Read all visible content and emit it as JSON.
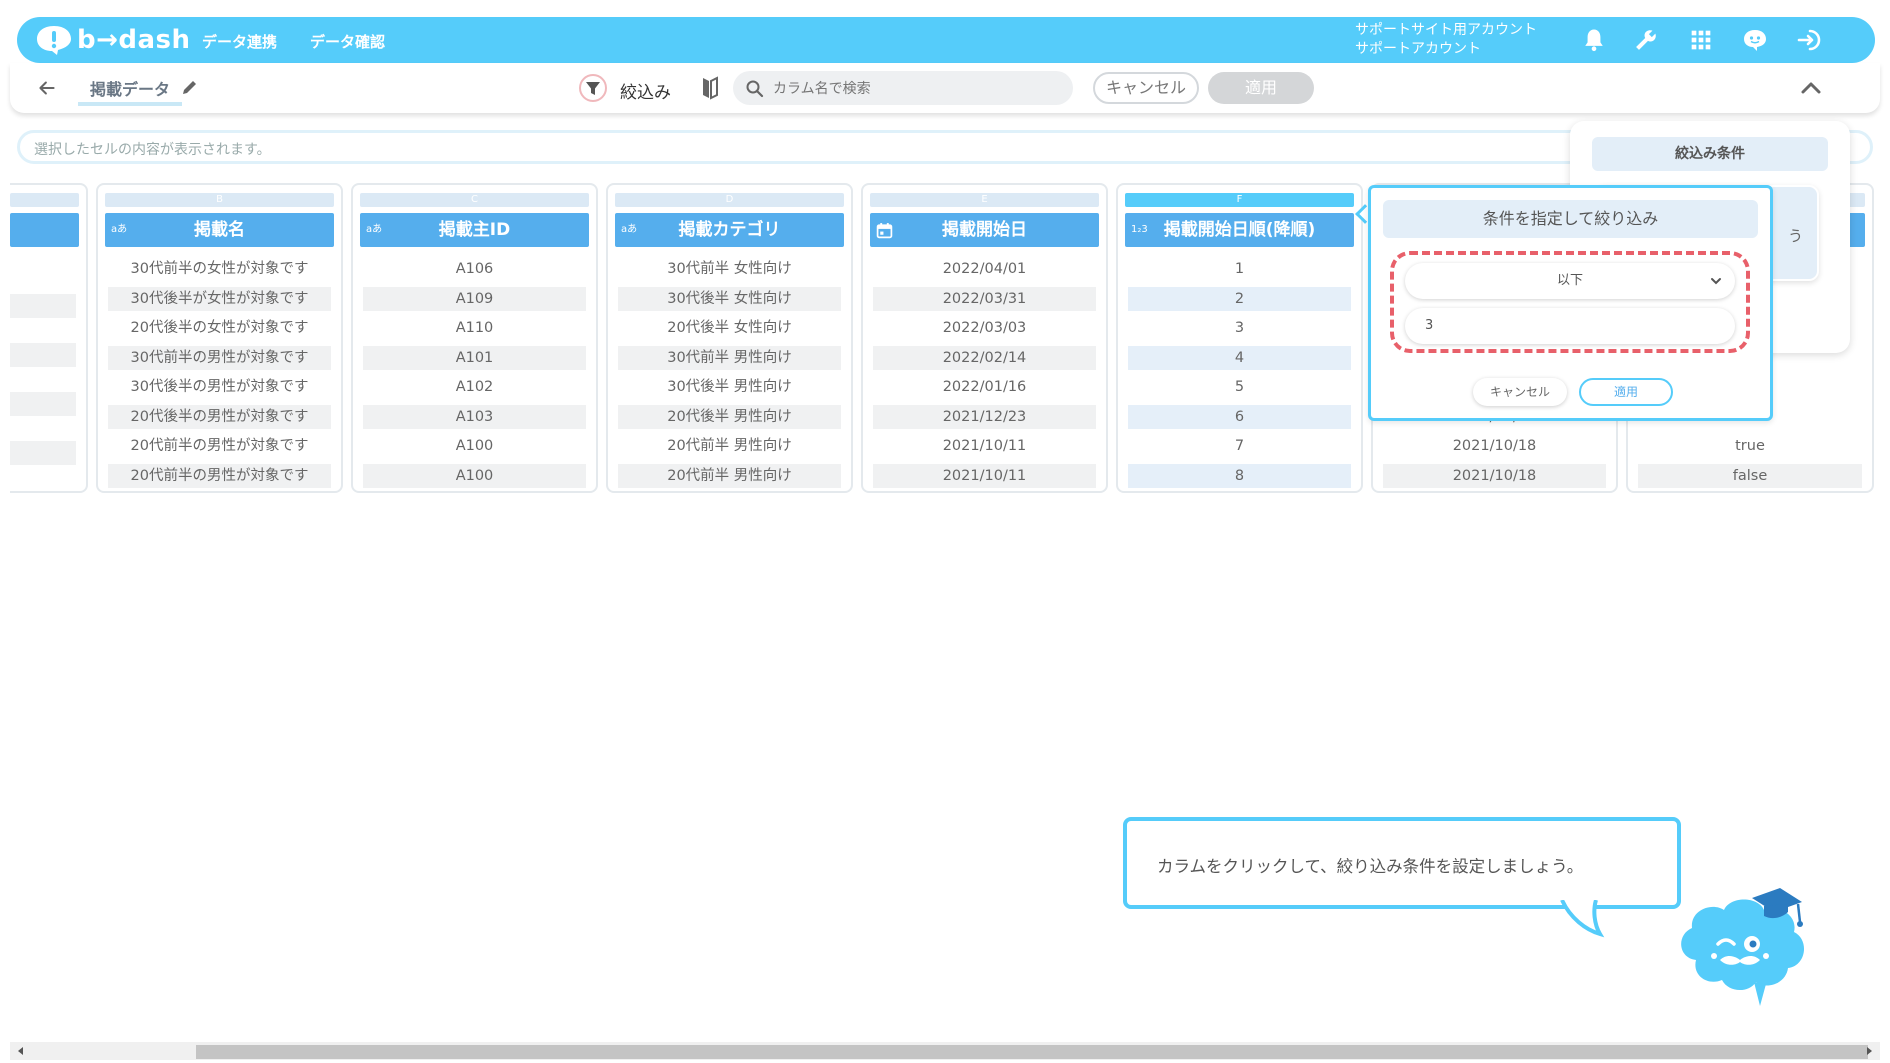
{
  "header": {
    "logo_text": "b→dash",
    "nav": [
      "データ連携",
      "データ確認"
    ],
    "account_line1": "サポートサイト用アカウント",
    "account_line2": "サポートアカウント",
    "icons": [
      "bell-icon",
      "wrench-icon",
      "apps-grid-icon",
      "chat-bot-icon",
      "logout-icon"
    ]
  },
  "toolbar": {
    "title": "掲載データ",
    "filter_label": "絞込み",
    "search_placeholder": "カラム名で検索",
    "cancel_label": "キャンセル",
    "apply_label": "適用"
  },
  "cellbar": {
    "placeholder": "選択したセルの内容が表示されます。"
  },
  "columns": [
    {
      "letter": "B",
      "type": "aあ",
      "name": "掲載名",
      "cells": [
        "30代前半の女性が対象です",
        "30代後半が女性が対象です",
        "20代後半の女性が対象です",
        "30代前半の男性が対象です",
        "30代後半の男性が対象です",
        "20代後半の男性が対象です",
        "20代前半の男性が対象です",
        "20代前半の男性が対象です"
      ]
    },
    {
      "letter": "C",
      "type": "aあ",
      "name": "掲載主ID",
      "cells": [
        "A106",
        "A109",
        "A110",
        "A101",
        "A102",
        "A103",
        "A100",
        "A100"
      ]
    },
    {
      "letter": "D",
      "type": "aあ",
      "name": "掲載カテゴリ",
      "cells": [
        "30代前半 女性向け",
        "30代後半 女性向け",
        "20代後半 女性向け",
        "30代前半 男性向け",
        "30代後半 男性向け",
        "20代後半 男性向け",
        "20代前半 男性向け",
        "20代前半 男性向け"
      ]
    },
    {
      "letter": "E",
      "type": "calendar",
      "name": "掲載開始日",
      "cells": [
        "2022/04/01",
        "2022/03/31",
        "2022/03/03",
        "2022/02/14",
        "2022/01/16",
        "2021/12/23",
        "2021/10/11",
        "2021/10/11"
      ]
    },
    {
      "letter": "F",
      "type": "1₂3",
      "name": "掲載開始日順(降順)",
      "cells": [
        "1",
        "2",
        "3",
        "4",
        "5",
        "6",
        "7",
        "8"
      ]
    }
  ],
  "partial_columns": {
    "g_cells": [
      "2021/10/18",
      "2021/10/18"
    ],
    "g_partial": "2021/12/30",
    "h_cells": [
      "true",
      "true",
      "false"
    ]
  },
  "popup": {
    "title": "条件を指定して絞り込み",
    "operator": "以下",
    "value": "3",
    "cancel_label": "キャンセル",
    "apply_label": "適用"
  },
  "side_panel": {
    "title": "絞込み条件",
    "card_text": "う"
  },
  "instruction": "カラムをクリックして、絞り込み条件を設定しましょう。",
  "colors": {
    "brand": "#55ccfa",
    "column_header": "#55aeed",
    "highlight_dash": "#e8606a"
  }
}
